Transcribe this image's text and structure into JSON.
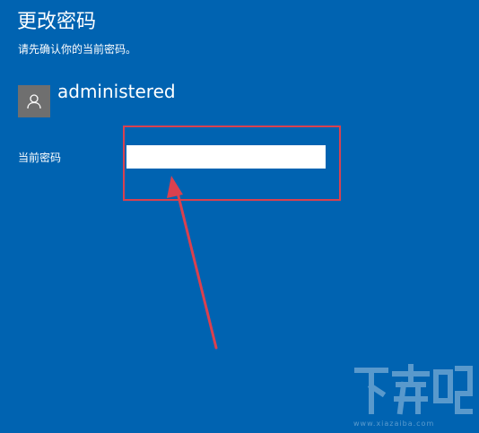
{
  "dialog": {
    "title": "更改密码",
    "subtitle": "请先确认你的当前密码。"
  },
  "user": {
    "name": "administered",
    "avatar_icon": "user-icon"
  },
  "form": {
    "current_password_label": "当前密码",
    "current_password_value": ""
  },
  "annotation": {
    "highlight_color": "#d9414f",
    "arrow_color": "#d9414f"
  },
  "watermark": {
    "logo_text": "下载吧",
    "url_text": "www.xiazaiba.com"
  },
  "colors": {
    "background": "#0063b1",
    "avatar_bg": "#6f6f6f"
  }
}
